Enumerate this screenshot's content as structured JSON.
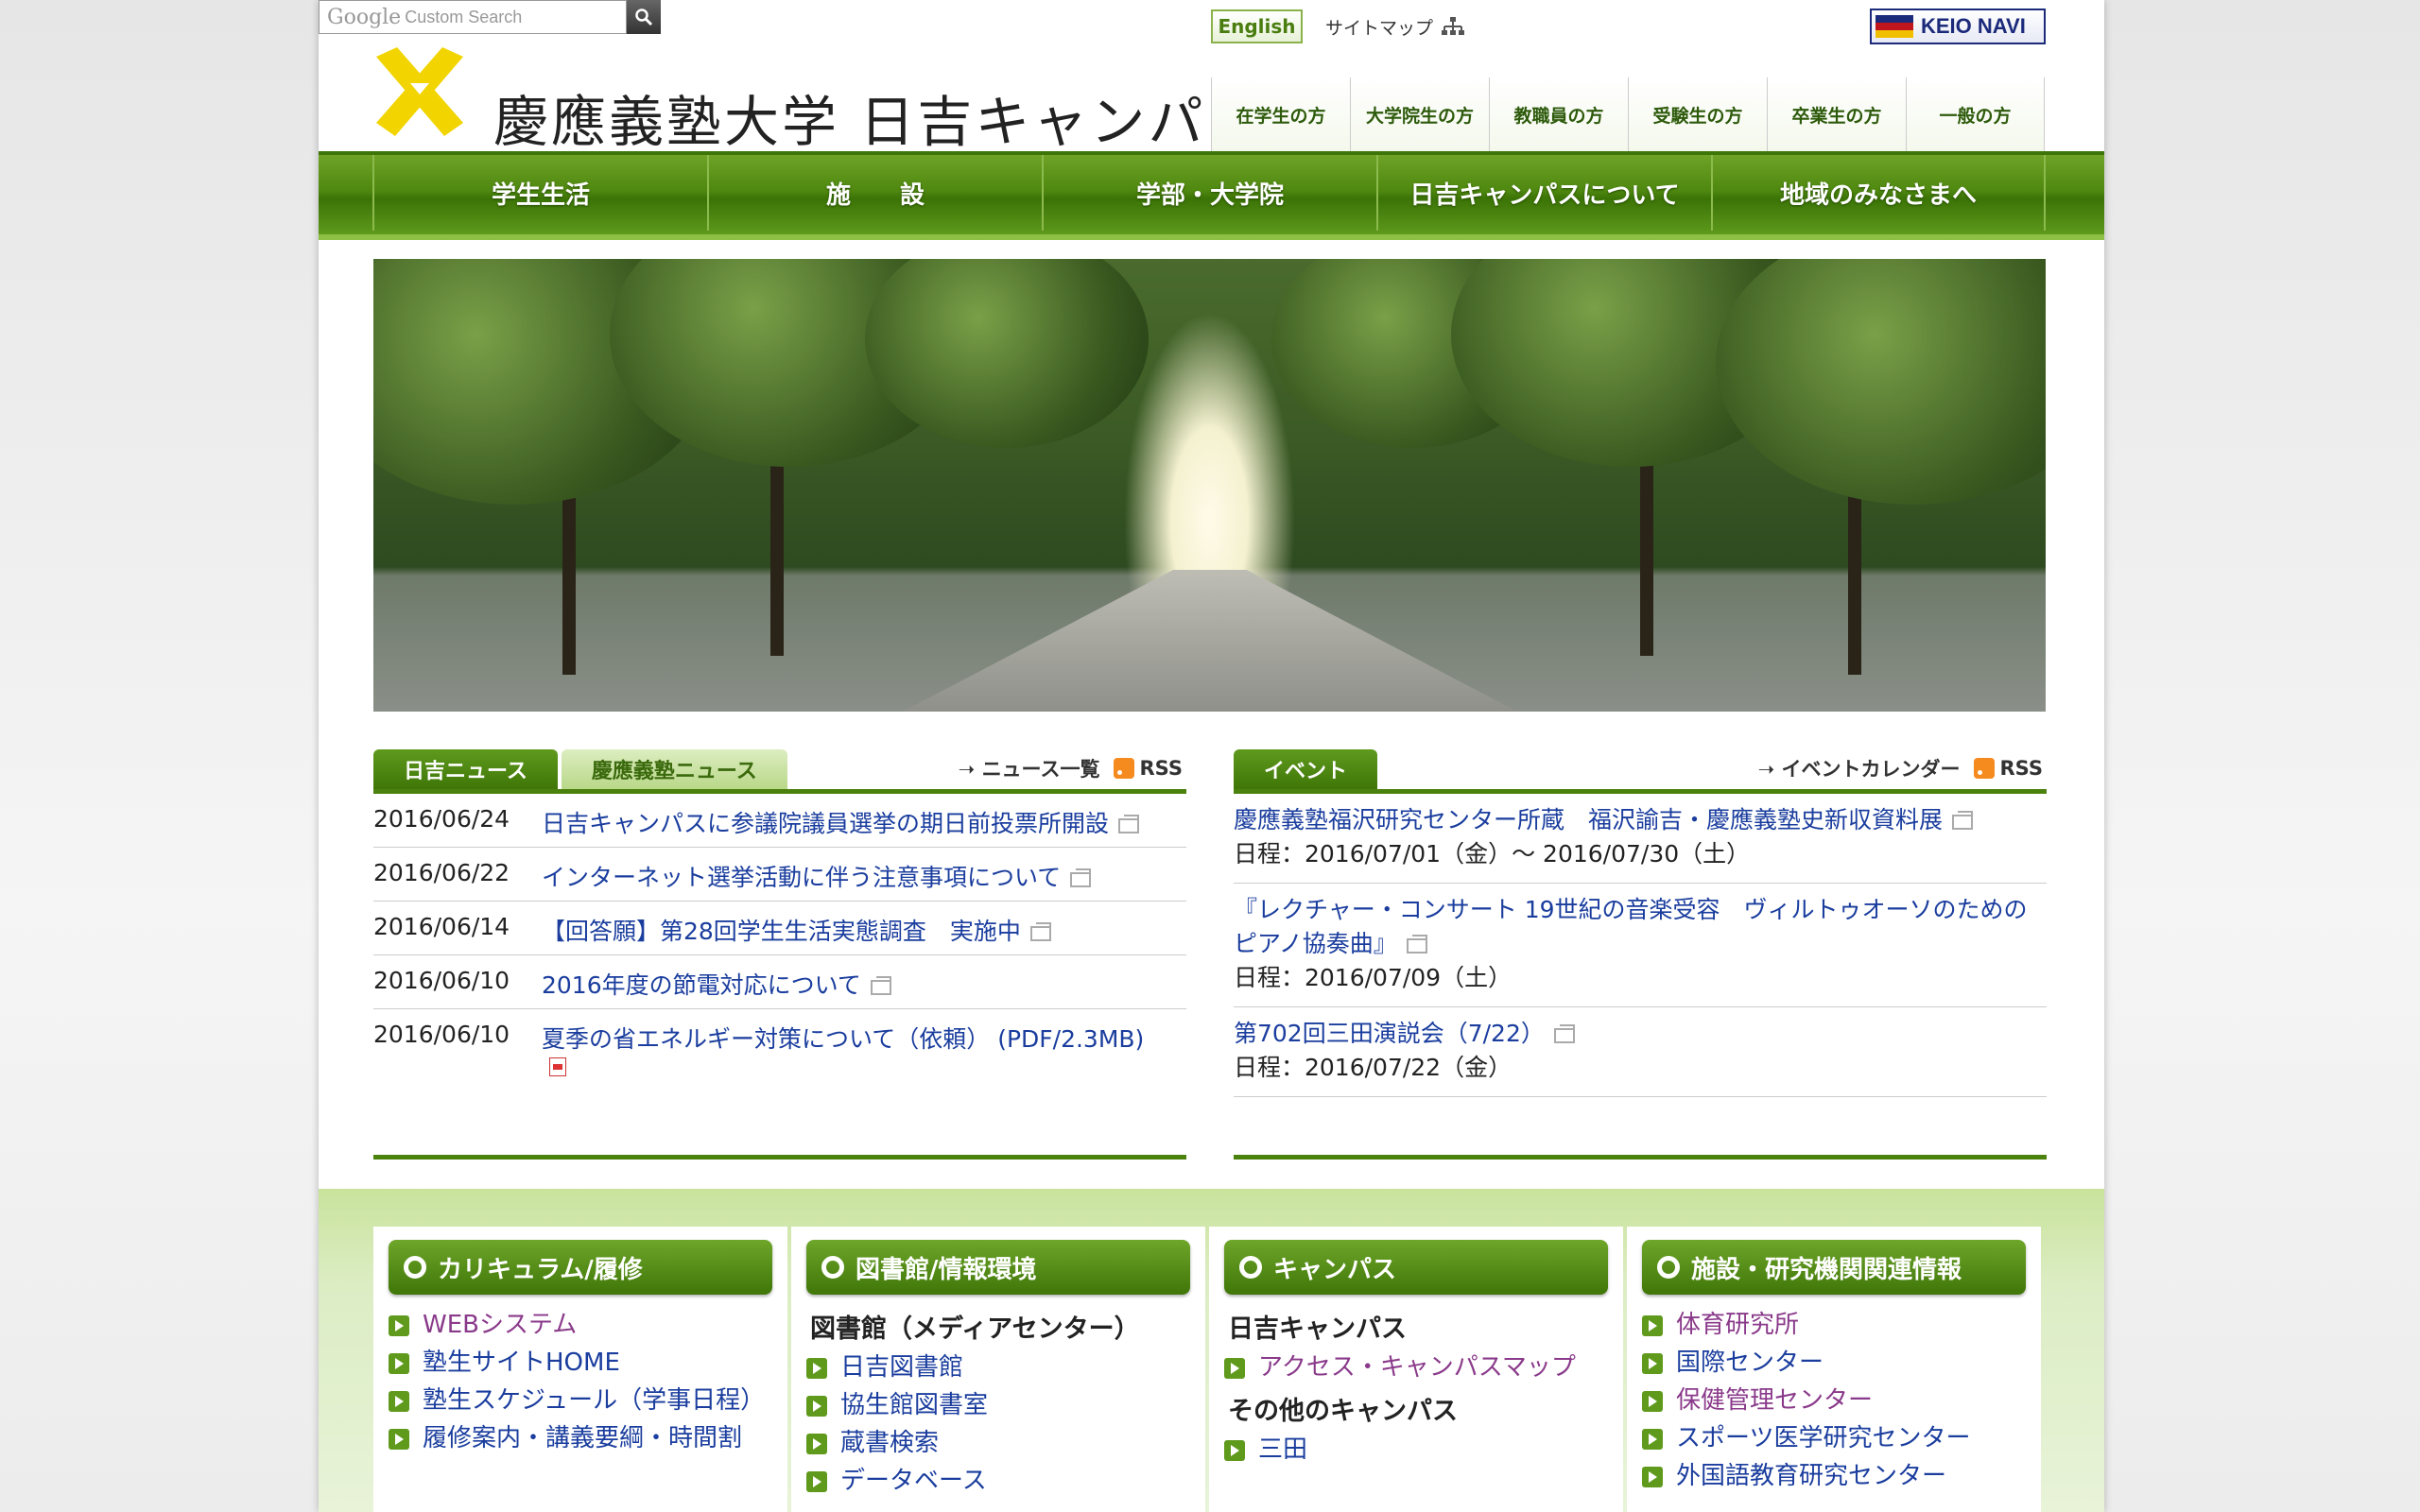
{
  "header": {
    "site_title": "慶應義塾大学 日吉キャンパス",
    "english_label": "English",
    "sitemap_label": "サイトマップ",
    "search": {
      "brand": "Google",
      "placeholder": "Custom Search"
    },
    "navi_label": "KEIO NAVI",
    "audience": [
      "在学生の方",
      "大学院生の方",
      "教職員の方",
      "受験生の方",
      "卒業生の方",
      "一般の方"
    ]
  },
  "gnav": [
    "学生生活",
    "施　　設",
    "学部・大学院",
    "日吉キャンパスについて",
    "地域のみなさまへ"
  ],
  "news": {
    "tabs": [
      "日吉ニュース",
      "慶應義塾ニュース"
    ],
    "list_link": "ニュース一覧",
    "rss_label": "RSS",
    "items": [
      {
        "date": "2016/06/24",
        "title": "日吉キャンパスに参議院議員選挙の期日前投票所開設"
      },
      {
        "date": "2016/06/22",
        "title": "インターネット選挙活動に伴う注意事項について"
      },
      {
        "date": "2016/06/14",
        "title": "【回答願】第28回学生生活実態調査　実施中"
      },
      {
        "date": "2016/06/10",
        "title": "2016年度の節電対応について"
      },
      {
        "date": "2016/06/10",
        "title": "夏季の省エネルギー対策について（依頼） (PDF/2.3MB)"
      }
    ]
  },
  "events": {
    "tab": "イベント",
    "calendar_link": "イベントカレンダー",
    "rss_label": "RSS",
    "items": [
      {
        "title": "慶應義塾福沢研究センター所蔵　福沢諭吉・慶應義塾史新収資料展",
        "date": "日程：2016/07/01（金）〜 2016/07/30（土）"
      },
      {
        "title": "『レクチャー・コンサート 19世紀の音楽受容　ヴィルトゥオーソのための ピアノ協奏曲』",
        "date": "日程：2016/07/09（土）"
      },
      {
        "title": "第702回三田演説会（7/22）",
        "date": "日程：2016/07/22（金）"
      }
    ]
  },
  "columns": [
    {
      "title": "カリキュラム/履修",
      "items": [
        "WEBシステム",
        "塾生サイトHOME",
        "塾生スケジュール（学事日程）",
        "履修案内・講義要綱・時間割"
      ]
    },
    {
      "title": "図書館/情報環境",
      "subhead": "図書館（メディアセンター）",
      "items": [
        "日吉図書館",
        "協生館図書室",
        "蔵書検索",
        "データベース"
      ]
    },
    {
      "title": "キャンパス",
      "subhead": "日吉キャンパス",
      "items": [
        "アクセス・キャンパスマップ"
      ],
      "subhead2": "その他のキャンパス",
      "items2": [
        "三田"
      ]
    },
    {
      "title": "施設・研究機関関連情報",
      "items": [
        "体育研究所",
        "国際センター",
        "保健管理センター",
        "スポーツ医学研究センター",
        "外国語教育研究センター"
      ]
    }
  ],
  "colors": {
    "brand_green": "#4b820e",
    "link_blue": "#1a3d9e",
    "visited_purple": "#8a3a8a",
    "logo_yellow": "#f2d400"
  }
}
